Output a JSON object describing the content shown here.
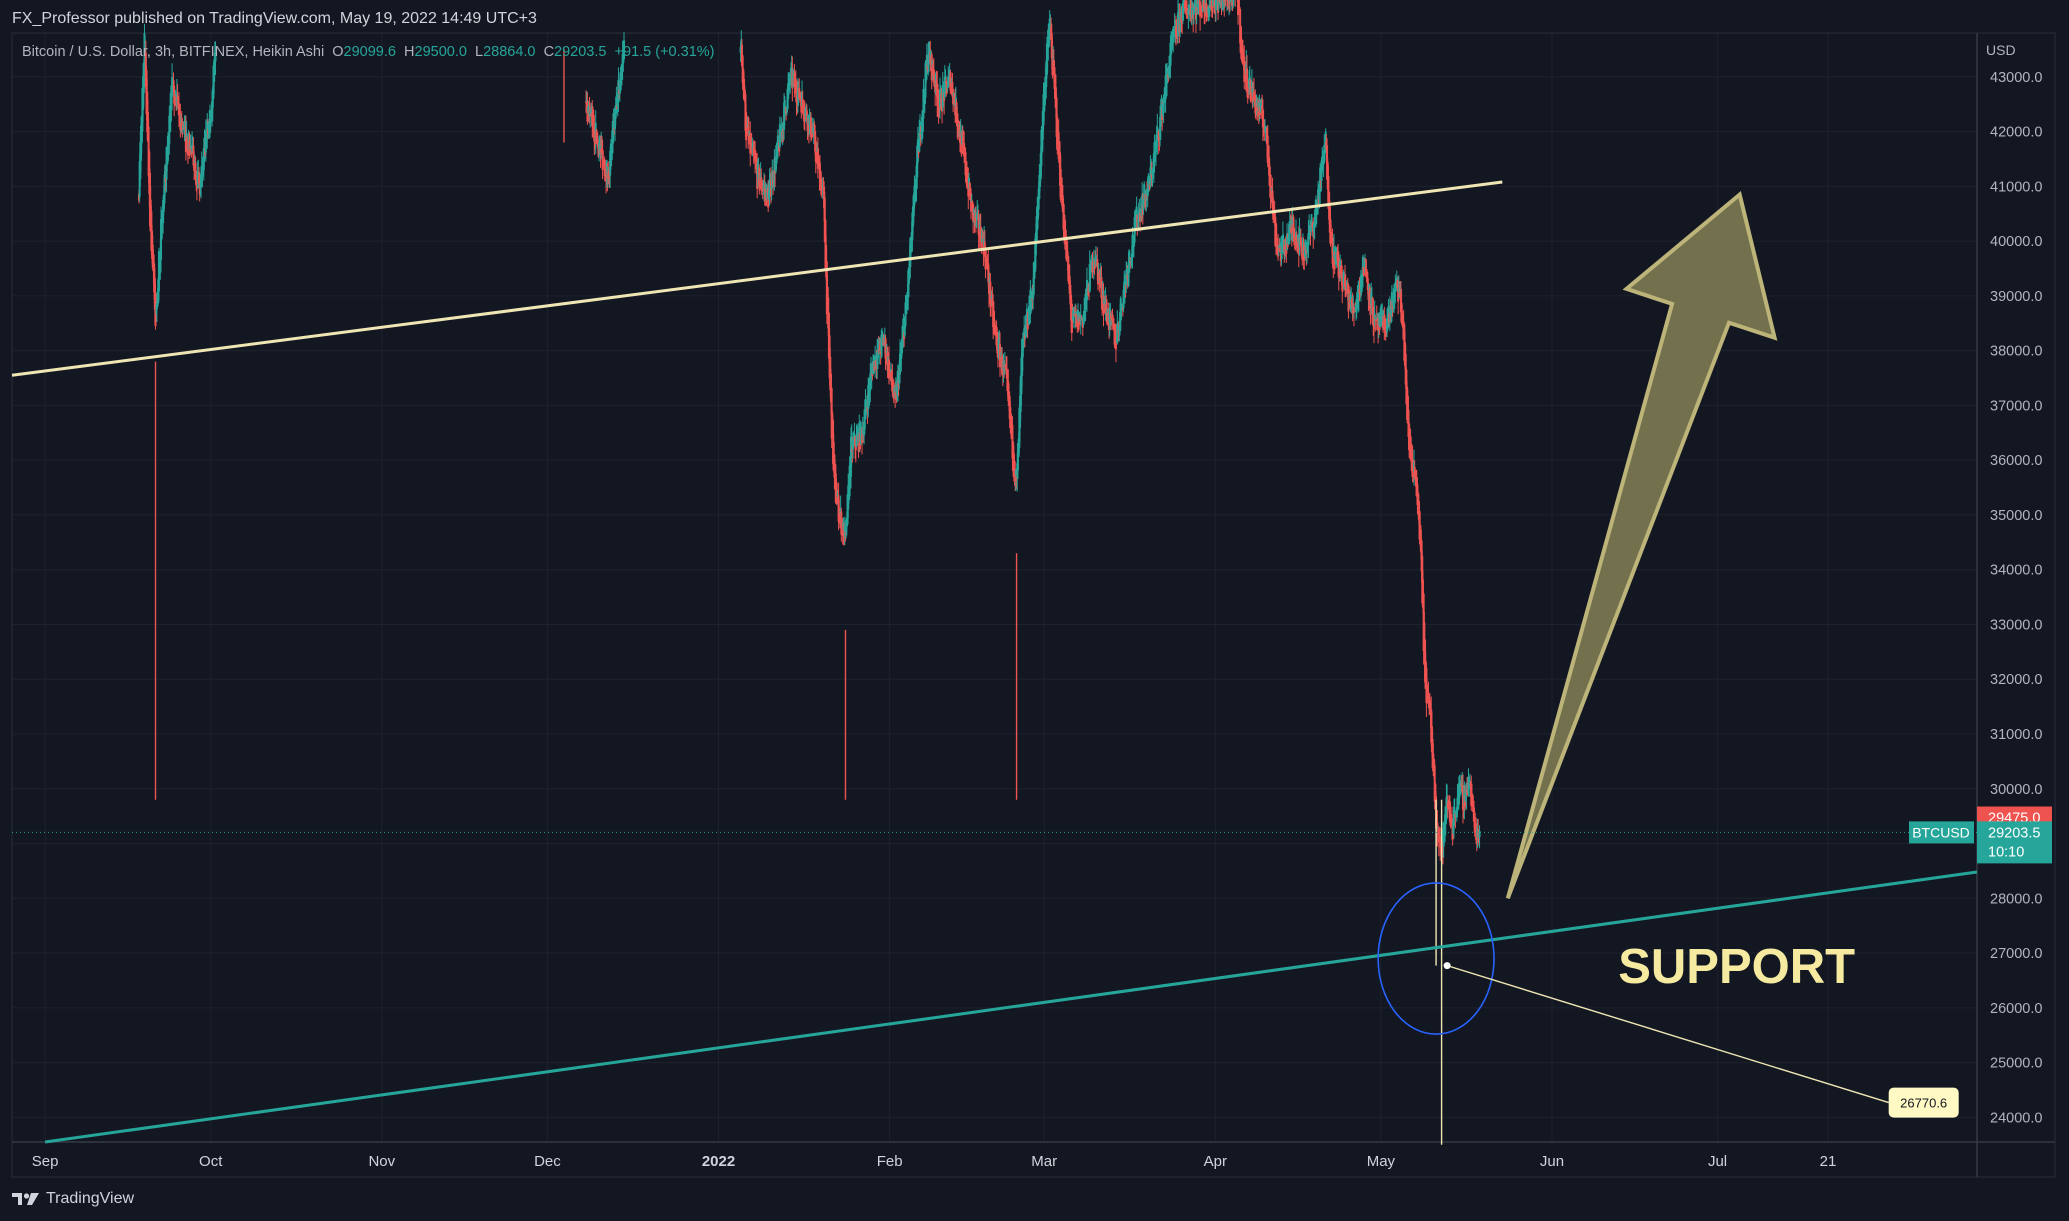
{
  "publisher_line": "FX_Professor published on TradingView.com, May 19, 2022 14:49 UTC+3",
  "legend": {
    "symbol_desc": "Bitcoin / U.S. Dollar, 3h, BITFINEX, Heikin Ashi",
    "o_label": "O",
    "o_value": "29099.6",
    "h_label": "H",
    "h_value": "29500.0",
    "l_label": "L",
    "l_value": "28864.0",
    "c_label": "C",
    "c_value": "29203.5",
    "change": "+91.5 (+0.31%)"
  },
  "brand": "TradingView",
  "colors": {
    "background": "#131722",
    "up": "#26a69a",
    "down": "#ef5350",
    "resistance": "#efe6b4",
    "support": "#26a69a",
    "circle": "#2962ff",
    "arrow_fill": "#7d7a52",
    "arrow_stroke": "#bdb47a",
    "support_text": "#f5eaa0"
  },
  "chart_data": {
    "type": "candlestick",
    "style": "Heikin Ashi",
    "symbol": "BTCUSD",
    "timeframe": "3h",
    "exchange": "BITFINEX",
    "currency_label": "USD",
    "ylim": [
      23550,
      43800
    ],
    "x_domain": [
      "2021-08-26",
      "2022-08-17"
    ],
    "y_ticks": [
      24000,
      25000,
      26000,
      27000,
      28000,
      29000,
      30000,
      31000,
      32000,
      33000,
      34000,
      35000,
      36000,
      37000,
      38000,
      39000,
      40000,
      41000,
      42000,
      43000
    ],
    "y_tick_labels": [
      "24000.0",
      "25000.0",
      "26000.0",
      "27000.0",
      "28000.0",
      "29000.0",
      "30000.0",
      "31000.0",
      "32000.0",
      "33000.0",
      "34000.0",
      "35000.0",
      "36000.0",
      "37000.0",
      "38000.0",
      "39000.0",
      "40000.0",
      "41000.0",
      "42000.0",
      "43000.0"
    ],
    "x_ticks": [
      {
        "label": "Sep",
        "date": "2021-09-01"
      },
      {
        "label": "Oct",
        "date": "2021-10-01"
      },
      {
        "label": "Nov",
        "date": "2021-11-01"
      },
      {
        "label": "Dec",
        "date": "2021-12-01"
      },
      {
        "label": "2022",
        "date": "2022-01-01",
        "bold": true
      },
      {
        "label": "Feb",
        "date": "2022-02-01"
      },
      {
        "label": "Mar",
        "date": "2022-03-01"
      },
      {
        "label": "Apr",
        "date": "2022-04-01"
      },
      {
        "label": "May",
        "date": "2022-05-01"
      },
      {
        "label": "Jun",
        "date": "2022-06-01"
      },
      {
        "label": "Jul",
        "date": "2022-07-01"
      },
      {
        "label": "21",
        "date": "2022-07-21"
      }
    ],
    "grid": true,
    "price_path": [
      {
        "date": "2021-09-18",
        "price": 41000
      },
      {
        "date": "2021-09-19",
        "price": 43700
      },
      {
        "date": "2021-09-20",
        "price": 40500
      },
      {
        "date": "2021-09-21",
        "price": 38500
      },
      {
        "date": "2021-09-22",
        "price": 40200
      },
      {
        "date": "2021-09-24",
        "price": 42800
      },
      {
        "date": "2021-09-26",
        "price": 42000
      },
      {
        "date": "2021-09-28",
        "price": 41500
      },
      {
        "date": "2021-09-29",
        "price": 40900
      },
      {
        "date": "2021-10-01",
        "price": 42500
      },
      {
        "date": "2021-10-02",
        "price": 43700
      },
      {
        "date": "2021-12-08",
        "price": 42500
      },
      {
        "date": "2021-12-12",
        "price": 41200
      },
      {
        "date": "2021-12-15",
        "price": 43700
      },
      {
        "date": "2022-01-05",
        "price": 43700
      },
      {
        "date": "2022-01-06",
        "price": 42000
      },
      {
        "date": "2022-01-08",
        "price": 41200
      },
      {
        "date": "2022-01-10",
        "price": 40800
      },
      {
        "date": "2022-01-12",
        "price": 41800
      },
      {
        "date": "2022-01-14",
        "price": 43000
      },
      {
        "date": "2022-01-16",
        "price": 42600
      },
      {
        "date": "2022-01-18",
        "price": 42000
      },
      {
        "date": "2022-01-20",
        "price": 40800
      },
      {
        "date": "2022-01-21",
        "price": 37800
      },
      {
        "date": "2022-01-22",
        "price": 35500
      },
      {
        "date": "2022-01-24",
        "price": 34500
      },
      {
        "date": "2022-01-25",
        "price": 36200
      },
      {
        "date": "2022-01-27",
        "price": 36500
      },
      {
        "date": "2022-01-29",
        "price": 37800
      },
      {
        "date": "2022-01-31",
        "price": 38200
      },
      {
        "date": "2022-02-02",
        "price": 37000
      },
      {
        "date": "2022-02-04",
        "price": 38800
      },
      {
        "date": "2022-02-06",
        "price": 41500
      },
      {
        "date": "2022-02-08",
        "price": 43500
      },
      {
        "date": "2022-02-10",
        "price": 42500
      },
      {
        "date": "2022-02-12",
        "price": 43000
      },
      {
        "date": "2022-02-14",
        "price": 41800
      },
      {
        "date": "2022-02-16",
        "price": 40500
      },
      {
        "date": "2022-02-18",
        "price": 40000
      },
      {
        "date": "2022-02-19",
        "price": 39200
      },
      {
        "date": "2022-02-20",
        "price": 38300
      },
      {
        "date": "2022-02-22",
        "price": 37500
      },
      {
        "date": "2022-02-24",
        "price": 35500
      },
      {
        "date": "2022-02-25",
        "price": 38000
      },
      {
        "date": "2022-02-27",
        "price": 39200
      },
      {
        "date": "2022-03-01",
        "price": 42800
      },
      {
        "date": "2022-03-02",
        "price": 44000
      },
      {
        "date": "2022-03-04",
        "price": 41000
      },
      {
        "date": "2022-03-06",
        "price": 38500
      },
      {
        "date": "2022-03-08",
        "price": 38600
      },
      {
        "date": "2022-03-10",
        "price": 39800
      },
      {
        "date": "2022-03-12",
        "price": 38800
      },
      {
        "date": "2022-03-14",
        "price": 38200
      },
      {
        "date": "2022-03-16",
        "price": 39500
      },
      {
        "date": "2022-03-18",
        "price": 40500
      },
      {
        "date": "2022-03-20",
        "price": 41000
      },
      {
        "date": "2022-03-22",
        "price": 42200
      },
      {
        "date": "2022-03-24",
        "price": 43500
      },
      {
        "date": "2022-03-26",
        "price": 44200
      },
      {
        "date": "2022-04-05",
        "price": 44500
      },
      {
        "date": "2022-04-06",
        "price": 43200
      },
      {
        "date": "2022-04-08",
        "price": 42600
      },
      {
        "date": "2022-04-10",
        "price": 42100
      },
      {
        "date": "2022-04-12",
        "price": 40000
      },
      {
        "date": "2022-04-13",
        "price": 39800
      },
      {
        "date": "2022-04-15",
        "price": 40300
      },
      {
        "date": "2022-04-17",
        "price": 39800
      },
      {
        "date": "2022-04-19",
        "price": 40400
      },
      {
        "date": "2022-04-21",
        "price": 41800
      },
      {
        "date": "2022-04-22",
        "price": 39900
      },
      {
        "date": "2022-04-24",
        "price": 39300
      },
      {
        "date": "2022-04-26",
        "price": 38700
      },
      {
        "date": "2022-04-28",
        "price": 39600
      },
      {
        "date": "2022-04-30",
        "price": 38400
      },
      {
        "date": "2022-05-02",
        "price": 38500
      },
      {
        "date": "2022-05-04",
        "price": 39200
      },
      {
        "date": "2022-05-05",
        "price": 38500
      },
      {
        "date": "2022-05-06",
        "price": 36300
      },
      {
        "date": "2022-05-07",
        "price": 35800
      },
      {
        "date": "2022-05-08",
        "price": 34800
      },
      {
        "date": "2022-05-09",
        "price": 32000
      },
      {
        "date": "2022-05-10",
        "price": 31200
      },
      {
        "date": "2022-05-11",
        "price": 29500
      },
      {
        "date": "2022-05-12",
        "price": 28800
      },
      {
        "date": "2022-05-13",
        "price": 29800
      },
      {
        "date": "2022-05-14",
        "price": 29300
      },
      {
        "date": "2022-05-15",
        "price": 30000
      },
      {
        "date": "2022-05-16",
        "price": 29800
      },
      {
        "date": "2022-05-17",
        "price": 30200
      },
      {
        "date": "2022-05-18",
        "price": 29200
      },
      {
        "date": "2022-05-19",
        "price": 29203.5
      }
    ],
    "wick_extremes": [
      {
        "date": "2021-09-21",
        "low": 37800
      },
      {
        "date": "2021-12-04",
        "high": 43500,
        "low": 41800
      },
      {
        "date": "2022-01-24",
        "low": 32900
      },
      {
        "date": "2022-02-24",
        "low": 34300
      },
      {
        "date": "2022-05-11",
        "low": 26770.6
      },
      {
        "date": "2022-05-12",
        "low": 23500
      }
    ],
    "last_price": {
      "value": 29203.5,
      "label": "29203.5",
      "countdown": "10:10",
      "symbol_label": "BTCUSD"
    },
    "high_marker": {
      "value": 29475.0,
      "label": "29475.0"
    },
    "drawings": {
      "resistance_line": {
        "p1": {
          "date": "2021-08-26",
          "price": 37550
        },
        "p2": {
          "date": "2022-05-23",
          "price": 41080
        }
      },
      "support_line": {
        "p1": {
          "date": "2021-09-01",
          "price": 23550
        },
        "p2": {
          "date": "2022-08-17",
          "price": 28480
        }
      },
      "circle": {
        "center": {
          "date": "2022-05-11",
          "price": 26900
        },
        "rx_days": 10.5,
        "ry_price": 1380
      },
      "price_label": {
        "text": "26770.6",
        "anchor": {
          "date": "2022-05-13",
          "price": 26770.6
        },
        "at": {
          "date": "2022-08-01",
          "price": 24270
        }
      },
      "support_text": {
        "text": "SUPPORT",
        "at": {
          "date": "2022-06-13",
          "price": 26450
        }
      },
      "arrow": {
        "tail": {
          "date": "2022-05-24",
          "price": 28000
        },
        "tip": {
          "date": "2022-07-05",
          "price": 40850
        }
      }
    }
  }
}
